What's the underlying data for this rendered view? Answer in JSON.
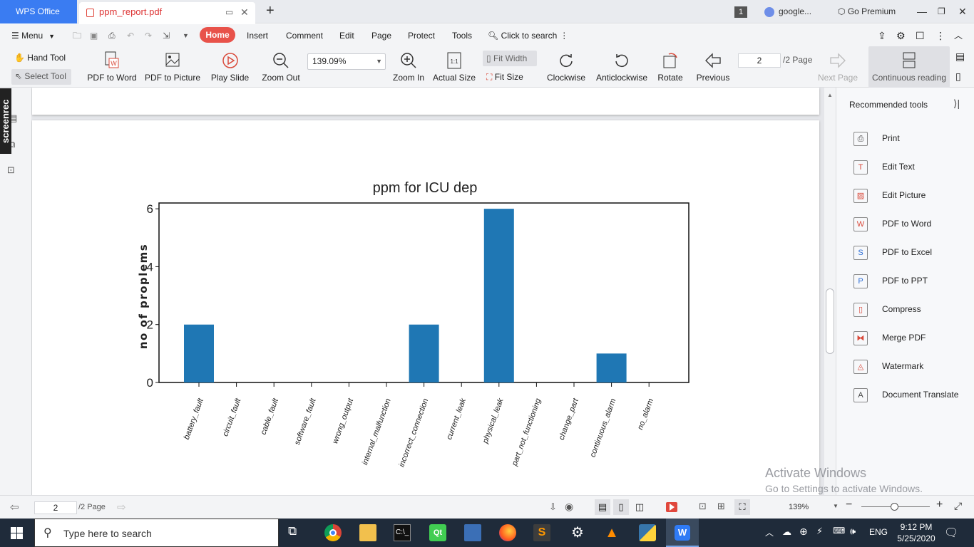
{
  "titlebar": {
    "app_name": "WPS Office",
    "doc_tab": "ppm_report.pdf",
    "page_counter": "1",
    "account": "google...",
    "premium": "Go Premium"
  },
  "menubar": {
    "menu": "Menu",
    "tabs": [
      "Home",
      "Insert",
      "Comment",
      "Edit",
      "Page",
      "Protect",
      "Tools"
    ],
    "search": "Click to search"
  },
  "toolbar": {
    "hand_tool": "Hand Tool",
    "select_tool": "Select Tool",
    "pdf_to_word": "PDF to Word",
    "pdf_to_picture": "PDF to Picture",
    "play_slide": "Play Slide",
    "zoom_out": "Zoom Out",
    "zoom_value": "139.09%",
    "zoom_in": "Zoom In",
    "actual_size": "Actual Size",
    "fit_width": "Fit Width",
    "fit_size": "Fit Size",
    "clockwise": "Clockwise",
    "anticlockwise": "Anticlockwise",
    "rotate": "Rotate",
    "previous": "Previous",
    "page_input": "2",
    "page_total": "/2 Page",
    "next_page": "Next Page",
    "continuous_reading": "Continuous reading"
  },
  "side": {
    "screenrec": "screenrec"
  },
  "right_panel": {
    "title": "Recommended tools",
    "items": [
      {
        "label": "Print",
        "icon": "printer-icon"
      },
      {
        "label": "Edit Text",
        "icon": "edit-text-icon"
      },
      {
        "label": "Edit Picture",
        "icon": "picture-icon"
      },
      {
        "label": "PDF to Word",
        "icon": "pdf-word-icon"
      },
      {
        "label": "PDF to Excel",
        "icon": "pdf-excel-icon"
      },
      {
        "label": "PDF to PPT",
        "icon": "pdf-ppt-icon"
      },
      {
        "label": "Compress",
        "icon": "compress-icon"
      },
      {
        "label": "Merge PDF",
        "icon": "merge-icon"
      },
      {
        "label": "Watermark",
        "icon": "watermark-icon"
      },
      {
        "label": "Document Translate",
        "icon": "translate-icon"
      }
    ]
  },
  "watermark": {
    "line1": "Activate Windows",
    "line2": "Go to Settings to activate Windows."
  },
  "statusbar": {
    "page_input": "2",
    "page_total": "/2 Page",
    "zoom": "139%"
  },
  "taskbar": {
    "search_placeholder": "Type here to search",
    "language": "ENG",
    "time": "9:12 PM",
    "date": "5/25/2020"
  },
  "chart_data": {
    "type": "bar",
    "title": "ppm for ICU dep",
    "xlabel": "",
    "ylabel": "no of proplems",
    "ylim": [
      0,
      6.2
    ],
    "yticks": [
      "0",
      "2",
      "4",
      "6"
    ],
    "categories": [
      "battery_fault",
      "circuit_fault",
      "cable_fault",
      "software_fault",
      "wrong_output",
      "internal_malfunction",
      "incorrect_connection",
      "current_leak",
      "physical_leak",
      "part_not_functioning",
      "change_part",
      "continuous_alarm",
      "no_alarm"
    ],
    "values": [
      2,
      0,
      0,
      0,
      0,
      0,
      2,
      0,
      6,
      0,
      0,
      1,
      0
    ],
    "bar_color": "#1f77b4",
    "grid": false
  }
}
